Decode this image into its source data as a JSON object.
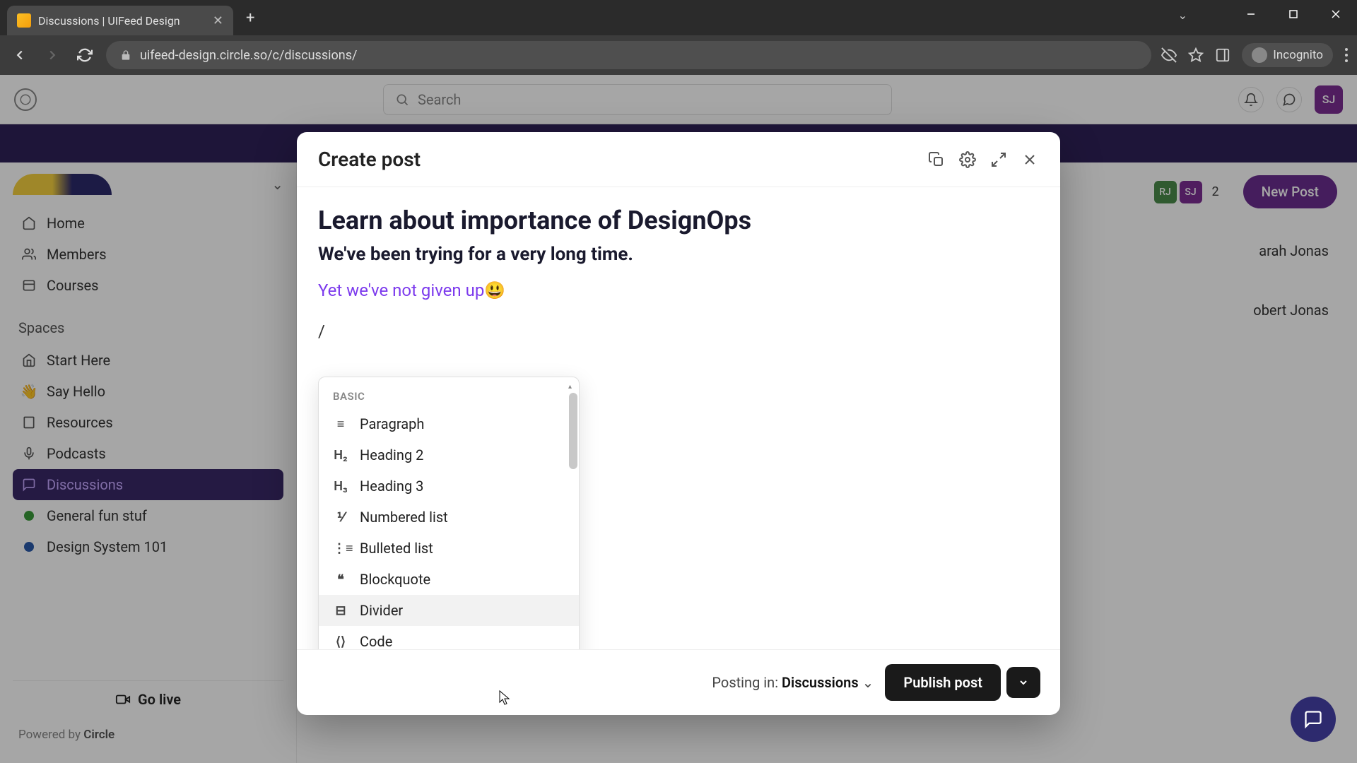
{
  "browser": {
    "tab_title": "Discussions | UIFeed Design",
    "url": "uifeed-design.circle.so/c/discussions/",
    "incognito_label": "Incognito"
  },
  "header": {
    "search_placeholder": "Search",
    "avatar_initials": "SJ"
  },
  "sidebar": {
    "nav": [
      {
        "icon": "home",
        "label": "Home"
      },
      {
        "icon": "members",
        "label": "Members"
      },
      {
        "icon": "courses",
        "label": "Courses"
      }
    ],
    "spaces_label": "Spaces",
    "spaces": [
      {
        "icon": "house",
        "label": "Start Here"
      },
      {
        "icon": "wave",
        "label": "Say Hello"
      },
      {
        "icon": "book",
        "label": "Resources"
      },
      {
        "icon": "mic",
        "label": "Podcasts"
      },
      {
        "icon": "chat",
        "label": "Discussions",
        "active": true
      },
      {
        "icon": "dot-green",
        "label": "General fun stuf"
      },
      {
        "icon": "dot-blue",
        "label": "Design System 101"
      }
    ],
    "go_live": "Go live",
    "powered_prefix": "Powered by ",
    "powered_name": "Circle"
  },
  "content": {
    "avatars": [
      {
        "initials": "RJ",
        "cls": "rj"
      },
      {
        "initials": "SJ",
        "cls": "sj"
      }
    ],
    "count": "2",
    "new_post": "New Post",
    "right_names": [
      "arah Jonas",
      "obert Jonas"
    ]
  },
  "modal": {
    "title": "Create post",
    "post_title": "Learn about importance of DesignOps",
    "post_subtitle": "We've been trying for a very long time.",
    "post_link_text": "Yet we've not given up😃",
    "slash": "/",
    "slash_section": "BASIC",
    "slash_items": [
      {
        "icon": "≡",
        "label": "Paragraph"
      },
      {
        "icon": "H₂",
        "label": "Heading 2"
      },
      {
        "icon": "H₃",
        "label": "Heading 3"
      },
      {
        "icon": "⅟",
        "label": "Numbered list"
      },
      {
        "icon": "⋮≡",
        "label": "Bulleted list"
      },
      {
        "icon": "❝",
        "label": "Blockquote"
      },
      {
        "icon": "⊟",
        "label": "Divider",
        "highlighted": true
      },
      {
        "icon": "⟨⟩",
        "label": "Code"
      }
    ],
    "posting_in_prefix": "Posting in: ",
    "posting_in_space": "Discussions",
    "publish_label": "Publish post"
  }
}
